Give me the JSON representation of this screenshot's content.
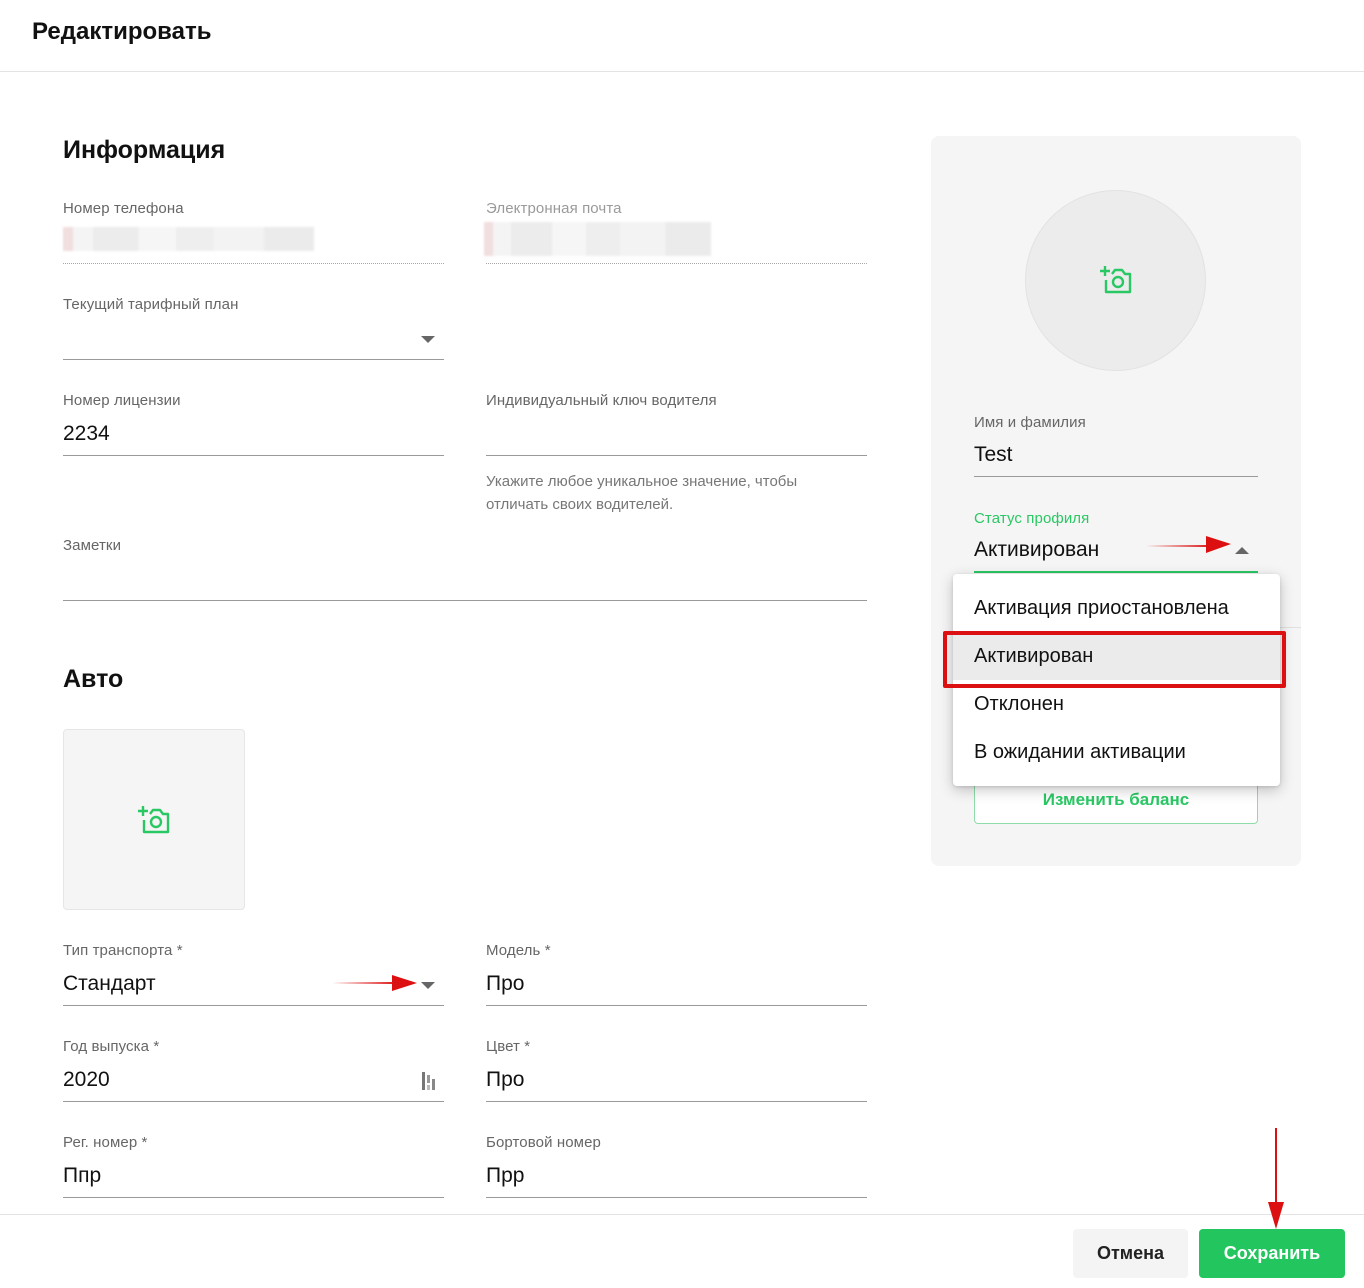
{
  "header": {
    "title": "Редактировать"
  },
  "info": {
    "section_title": "Информация",
    "phone": {
      "label": "Номер телефона",
      "value": ""
    },
    "email": {
      "label": "Электронная почта",
      "value": ""
    },
    "tariff": {
      "label": "Текущий тарифный план",
      "value": ""
    },
    "license": {
      "label": "Номер лицензии",
      "value": "2234"
    },
    "driver_key": {
      "label": "Индивидуальный ключ водителя",
      "value": "",
      "hint_line1": "Укажите любое уникальное значение, чтобы",
      "hint_line2": "отличать своих водителей."
    },
    "notes": {
      "label": "Заметки",
      "value": ""
    }
  },
  "auto": {
    "section_title": "Авто",
    "transport_type": {
      "label": "Тип транспорта *",
      "value": "Стандарт"
    },
    "model": {
      "label": "Модель *",
      "value": "Про"
    },
    "year": {
      "label": "Год выпуска *",
      "value": "2020"
    },
    "color": {
      "label": "Цвет *",
      "value": "Про"
    },
    "reg_number": {
      "label": "Рег. номер *",
      "value": "Ппр"
    },
    "board_number": {
      "label": "Бортовой номер",
      "value": "Прр"
    }
  },
  "profile": {
    "name": {
      "label": "Имя и фамилия",
      "value": "Test"
    },
    "status": {
      "label": "Статус профиля",
      "value": "Активирован"
    },
    "balance_button": "Изменить баланс"
  },
  "status_dropdown": {
    "options": [
      "Активация приостановлена",
      "Активирован",
      "Отклонен",
      "В ожидании активации"
    ],
    "selected_index": 1
  },
  "footer": {
    "cancel_label": "Отмена",
    "save_label": "Сохранить"
  },
  "colors": {
    "accent": "#22c55e",
    "annotation_red": "#dc1010"
  },
  "icons": [
    "add-photo-icon",
    "chevron-down-icon",
    "chevron-up-icon",
    "calendar-icon",
    "annotation-arrow"
  ]
}
